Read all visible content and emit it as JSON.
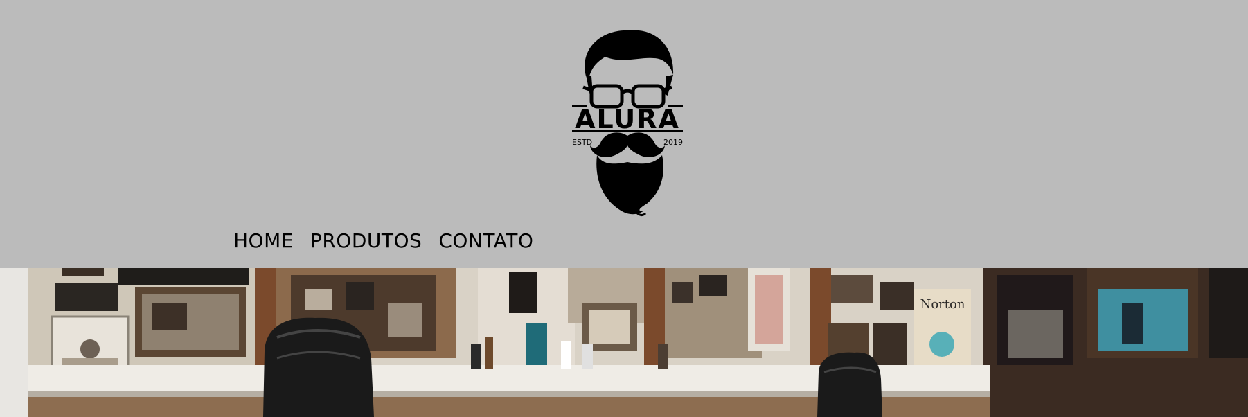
{
  "logo": {
    "brand": "ALURA",
    "left_text": "ESTD",
    "right_text": "2019",
    "icon": "bearded-man-glasses-logo"
  },
  "nav": {
    "items": [
      {
        "label": "HOME"
      },
      {
        "label": "PRODUTOS"
      },
      {
        "label": "CONTATO"
      }
    ]
  },
  "banner": {
    "icon": "barbershop-interior-photo",
    "poster_text": "Norton"
  },
  "colors": {
    "header_bg": "#bbbbbb",
    "nav_text": "#000000"
  }
}
